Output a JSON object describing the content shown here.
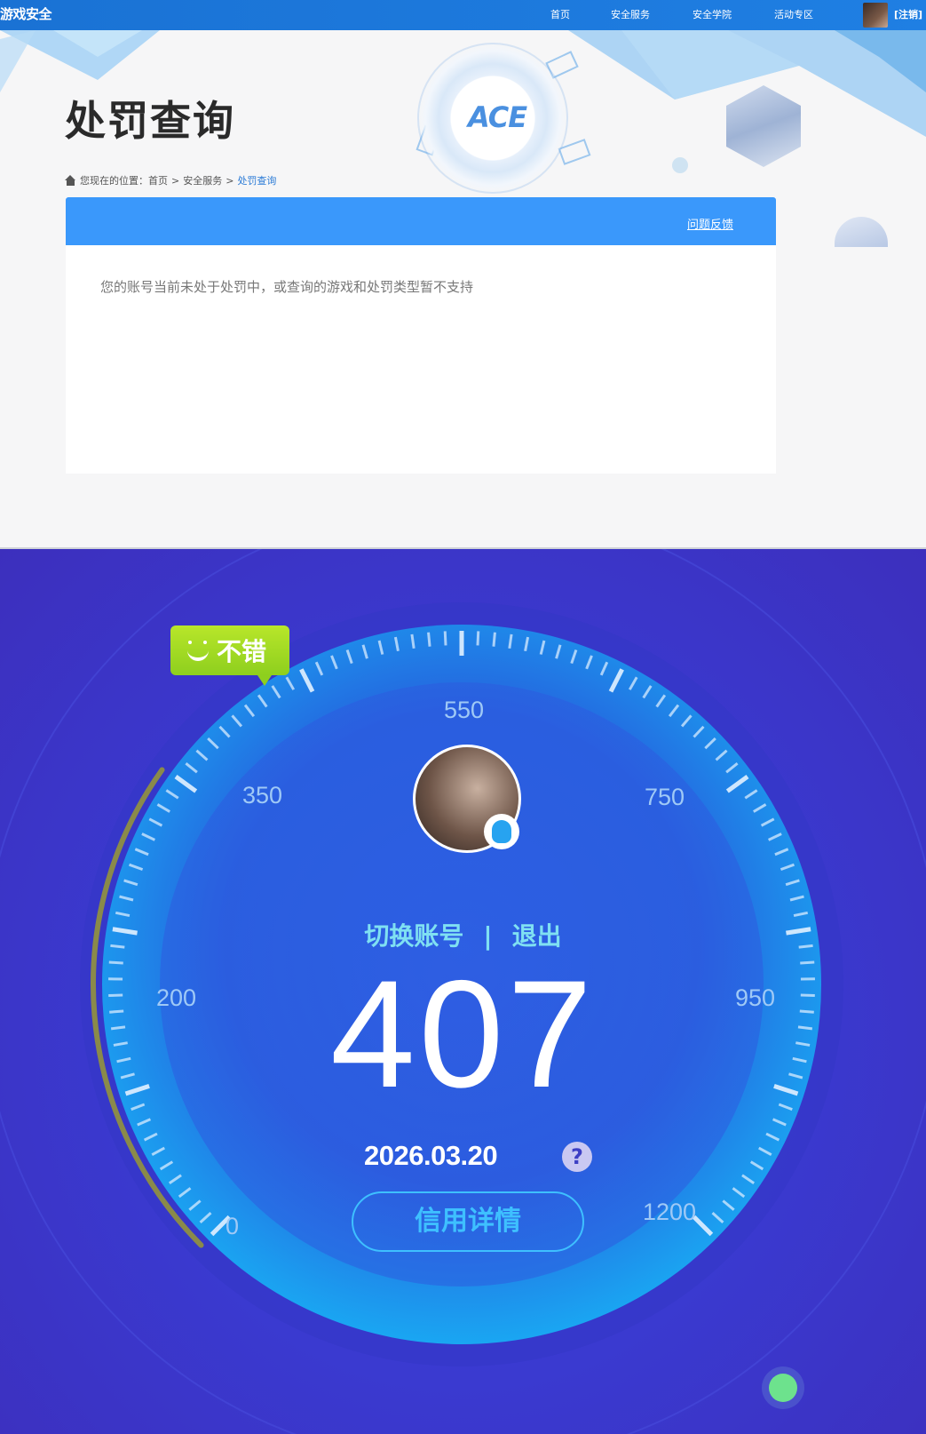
{
  "nav": {
    "logo": "游戏安全",
    "links": [
      "首页",
      "安全服务",
      "安全学院",
      "活动专区"
    ],
    "logout": "[注销]"
  },
  "header": {
    "title": "处罚查询",
    "logo_text": "ACE",
    "breadcrumb": {
      "prefix": "您现在的位置：",
      "items": [
        "首页",
        "安全服务"
      ],
      "current": "处罚查询",
      "separator": ">"
    }
  },
  "panel": {
    "feedback_link": "问题反馈",
    "message": "您的账号当前未处于处罚中，或查询的游戏和处罚类型暂不支持"
  },
  "credit": {
    "rating_label": "不错",
    "gauge_labels": [
      "0",
      "200",
      "350",
      "550",
      "750",
      "950",
      "1200"
    ],
    "switch_account": "切换账号",
    "divider": "|",
    "logout": "退出",
    "score": "407",
    "date": "2026.03.20",
    "help_icon": "?",
    "details_button": "信用详情",
    "score_min": 0,
    "score_max": 1200,
    "colors": {
      "background": "#3a3bd2",
      "accent": "#3ec0ff",
      "arc": "#8a8a4a",
      "rating": "#9ed923"
    }
  },
  "icons": {
    "home": "home-icon",
    "smile": "smile-icon",
    "qq": "qq-penguin-icon",
    "help": "question-circle-icon"
  }
}
